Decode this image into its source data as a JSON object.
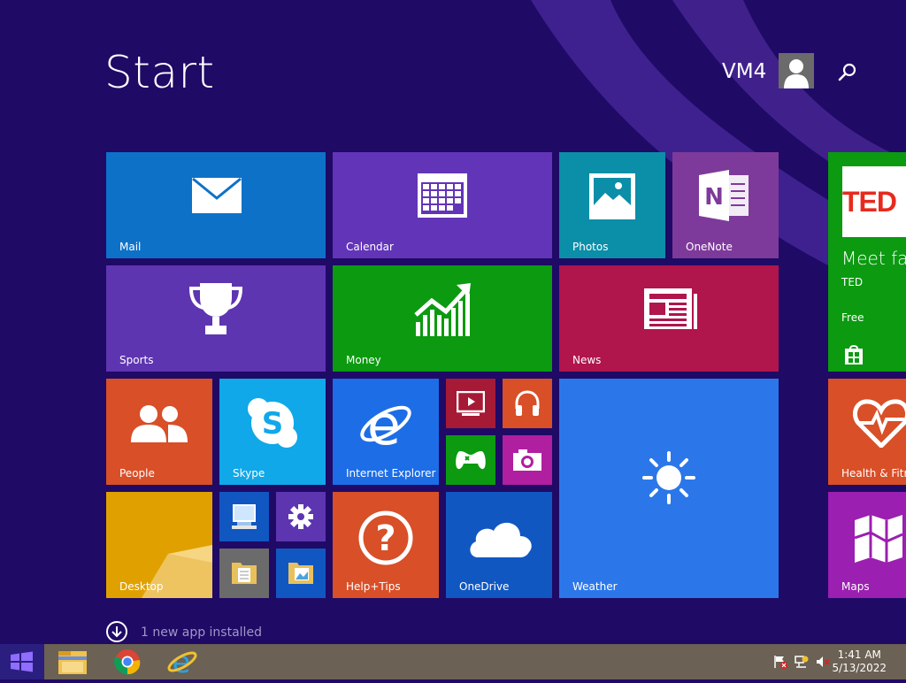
{
  "screen": {
    "title": "Start",
    "user": {
      "name": "VM4"
    }
  },
  "tiles": {
    "mail": "Mail",
    "calendar": "Calendar",
    "photos": "Photos",
    "onenote": "OneNote",
    "sports": "Sports",
    "money": "Money",
    "news": "News",
    "people": "People",
    "skype": "Skype",
    "ie": "Internet Explorer",
    "weather": "Weather",
    "desktop": "Desktop",
    "help": "Help+Tips",
    "onedrive": "OneDrive",
    "health": "Health & Fitne",
    "maps": "Maps",
    "ted": {
      "logo": "TED",
      "headline": "Meet fas",
      "publisher": "TED",
      "price": "Free"
    }
  },
  "notice": {
    "text": "1 new app installed"
  },
  "taskbar": {
    "time": "1:41 AM",
    "date": "5/13/2022",
    "pinned": [
      "file-explorer-icon",
      "chrome-icon",
      "internet-explorer-icon"
    ]
  },
  "colors": {
    "background": "#1f0a66",
    "mail": "#0e71c8",
    "calendar": "#6234b8",
    "photos": "#0b8ea7",
    "onenote": "#7e3a9b",
    "sports": "#5e35b1",
    "money": "#0b9a10",
    "news": "#b0154b",
    "people": "#d84f28",
    "skype": "#10a8e9",
    "ie": "#1d6de6",
    "weather": "#2b77ea",
    "desktop": "#e0a100",
    "help": "#d84f28",
    "onedrive": "#1157c2",
    "ted": "#0b9a10",
    "health": "#d84f28",
    "maps": "#9b1fb0",
    "taskbar": "#6b6154"
  }
}
